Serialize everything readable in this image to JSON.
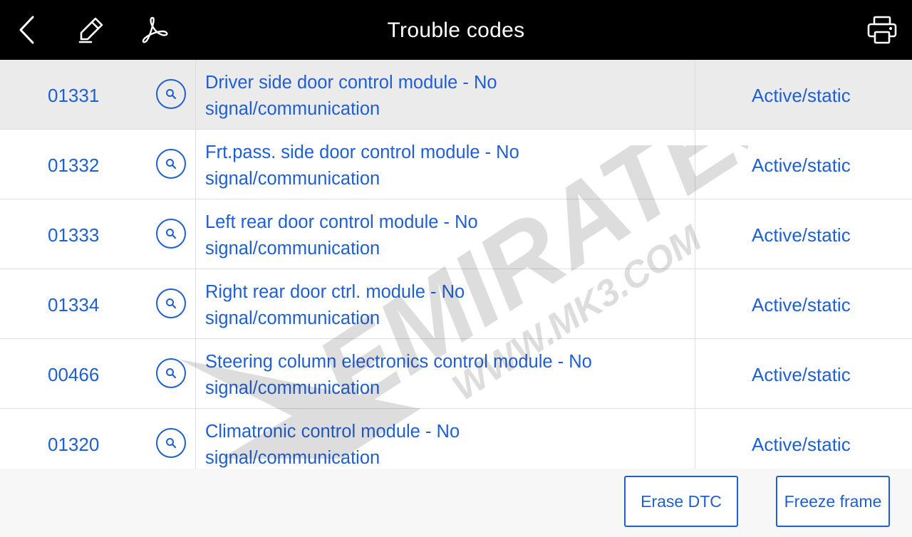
{
  "header": {
    "title": "Trouble codes",
    "icons": [
      "back-icon",
      "edit-icon",
      "pdf-icon",
      "print-icon"
    ]
  },
  "codes": [
    {
      "code": "01331",
      "description": "Driver side door control module - No signal/communication",
      "status": "Active/static",
      "selected": true
    },
    {
      "code": "01332",
      "description": "Frt.pass. side door control module - No signal/communication",
      "status": "Active/static",
      "selected": false
    },
    {
      "code": "01333",
      "description": "Left rear door control module - No signal/communication",
      "status": "Active/static",
      "selected": false
    },
    {
      "code": "01334",
      "description": "Right rear door ctrl. module - No signal/communication",
      "status": "Active/static",
      "selected": false
    },
    {
      "code": "00466",
      "description": "Steering column electronics control module - No signal/communication",
      "status": "Active/static",
      "selected": false
    },
    {
      "code": "01320",
      "description": "Climatronic control module - No signal/communication",
      "status": "Active/static",
      "selected": false
    }
  ],
  "row_icon": "search-icon",
  "watermark": {
    "brand": "EMIRATES",
    "url": "WWW.MK3.COM"
  },
  "footer": {
    "erase_label": "Erase DTC",
    "freeze_label": "Freeze frame"
  },
  "colors": {
    "accent": "#1f5fcf",
    "header_bg": "#000000",
    "selected_row_bg": "#ebebeb",
    "footer_bg": "#f7f7f7"
  }
}
